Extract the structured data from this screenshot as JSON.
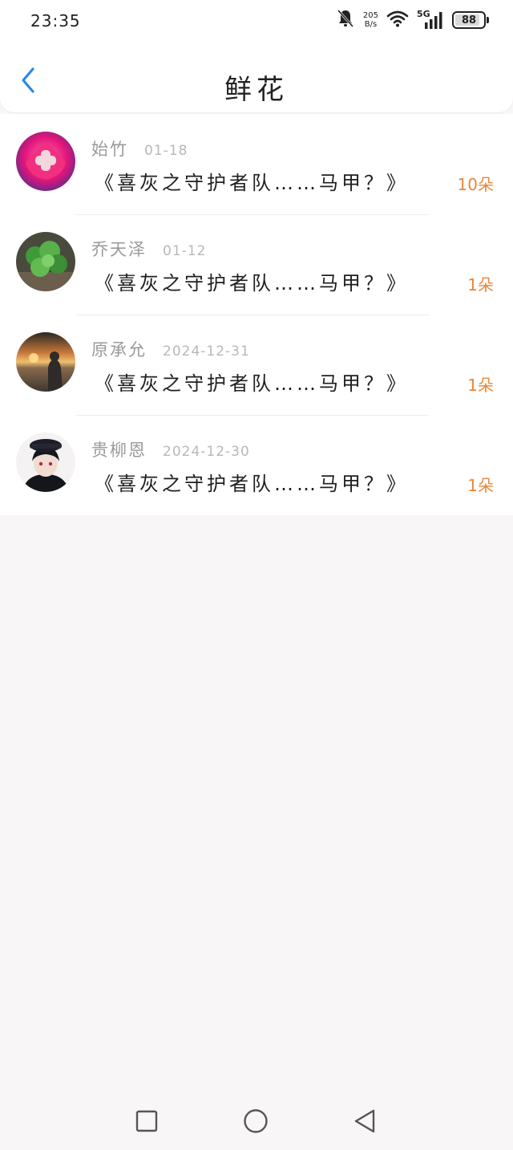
{
  "status_bar": {
    "time": "23:35",
    "net_speed_value": "205",
    "net_speed_unit": "B/s",
    "signal_type": "5G",
    "battery_level": "88",
    "battery_fraction": 0.88
  },
  "header": {
    "title": "鲜花",
    "back_icon": "chevron-left-icon"
  },
  "flower_records": [
    {
      "user": "始竹",
      "date": "01-18",
      "work": "《喜灰之守护者队……马甲？》",
      "count": "10朵"
    },
    {
      "user": "乔天泽",
      "date": "01-12",
      "work": "《喜灰之守护者队……马甲？》",
      "count": "1朵"
    },
    {
      "user": "原承允",
      "date": "2024-12-31",
      "work": "《喜灰之守护者队……马甲？》",
      "count": "1朵"
    },
    {
      "user": "贵柳恩",
      "date": "2024-12-30",
      "work": "《喜灰之守护者队……马甲？》",
      "count": "1朵"
    }
  ],
  "colors": {
    "accent_blue": "#2a8ae0",
    "flower_orange": "#e8873a",
    "background": "#f8f6f7"
  },
  "nav_icons": [
    "recent-apps-icon",
    "home-icon",
    "back-triangle-icon"
  ]
}
